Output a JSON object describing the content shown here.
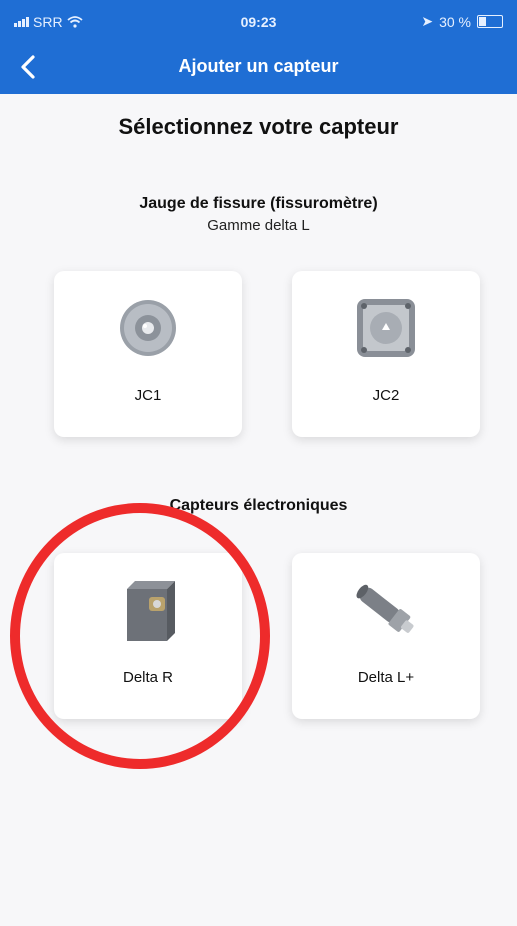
{
  "status_bar": {
    "carrier": "SRR",
    "time": "09:23",
    "battery": "30 %"
  },
  "nav": {
    "title": "Ajouter un capteur",
    "back_icon": "chevron-left-icon"
  },
  "page": {
    "title": "Sélectionnez votre capteur"
  },
  "sections": [
    {
      "title": "Jauge de fissure (fissuromètre)",
      "subtitle": "Gamme delta L",
      "cards": [
        {
          "label": "JC1",
          "icon": "round-gauge-icon"
        },
        {
          "label": "JC2",
          "icon": "square-gauge-icon"
        }
      ]
    },
    {
      "title": "Capteurs électroniques",
      "cards": [
        {
          "label": "Delta R",
          "icon": "box-sensor-icon"
        },
        {
          "label": "Delta L+",
          "icon": "cylinder-sensor-icon"
        }
      ]
    }
  ],
  "colors": {
    "header": "#1f6ed4",
    "highlight": "#ee2b2b"
  }
}
